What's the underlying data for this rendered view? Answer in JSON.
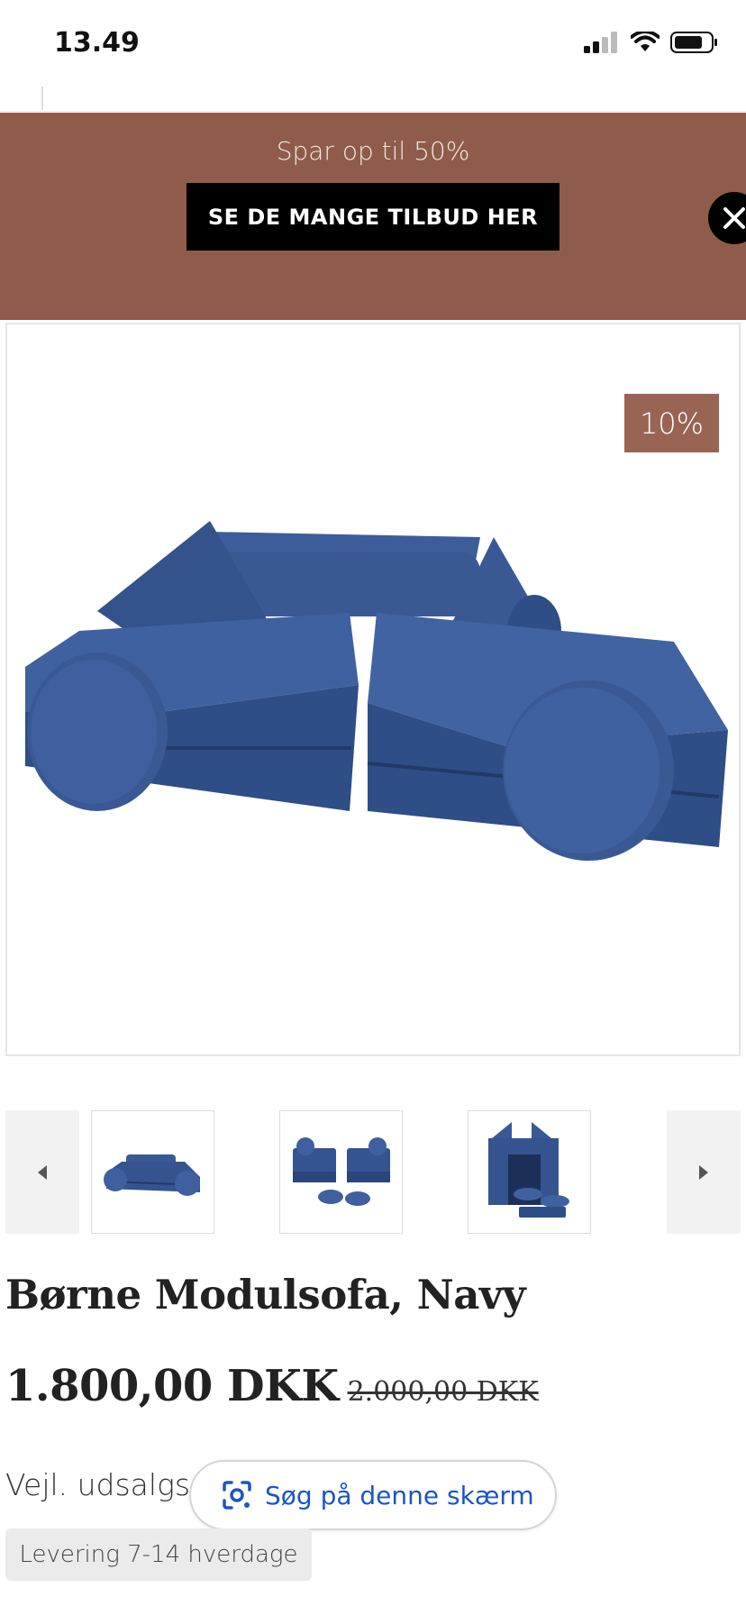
{
  "status_bar": {
    "time": "13.49"
  },
  "promo": {
    "text": "Spar op til 50%",
    "button_label": "SE DE MANGE TILBUD HER",
    "background_color": "#8f5c4b"
  },
  "product": {
    "discount_badge": "10%",
    "title": "Børne Modulsofa, Navy",
    "price_current": "1.800,00 DKK",
    "price_old": "2.000,00 DKK",
    "rrp_label": "Vejl. udsalgsp",
    "delivery": "Levering 7-14 hverdage",
    "color": "#35548f"
  },
  "gallery": {
    "thumbnails": [
      {
        "icon": "sofa-thumbnail"
      },
      {
        "icon": "armchairs-thumbnail"
      },
      {
        "icon": "playhouse-thumbnail"
      }
    ]
  },
  "lens_search": {
    "label": "Søg på denne skærm",
    "icon": "lens-icon"
  }
}
